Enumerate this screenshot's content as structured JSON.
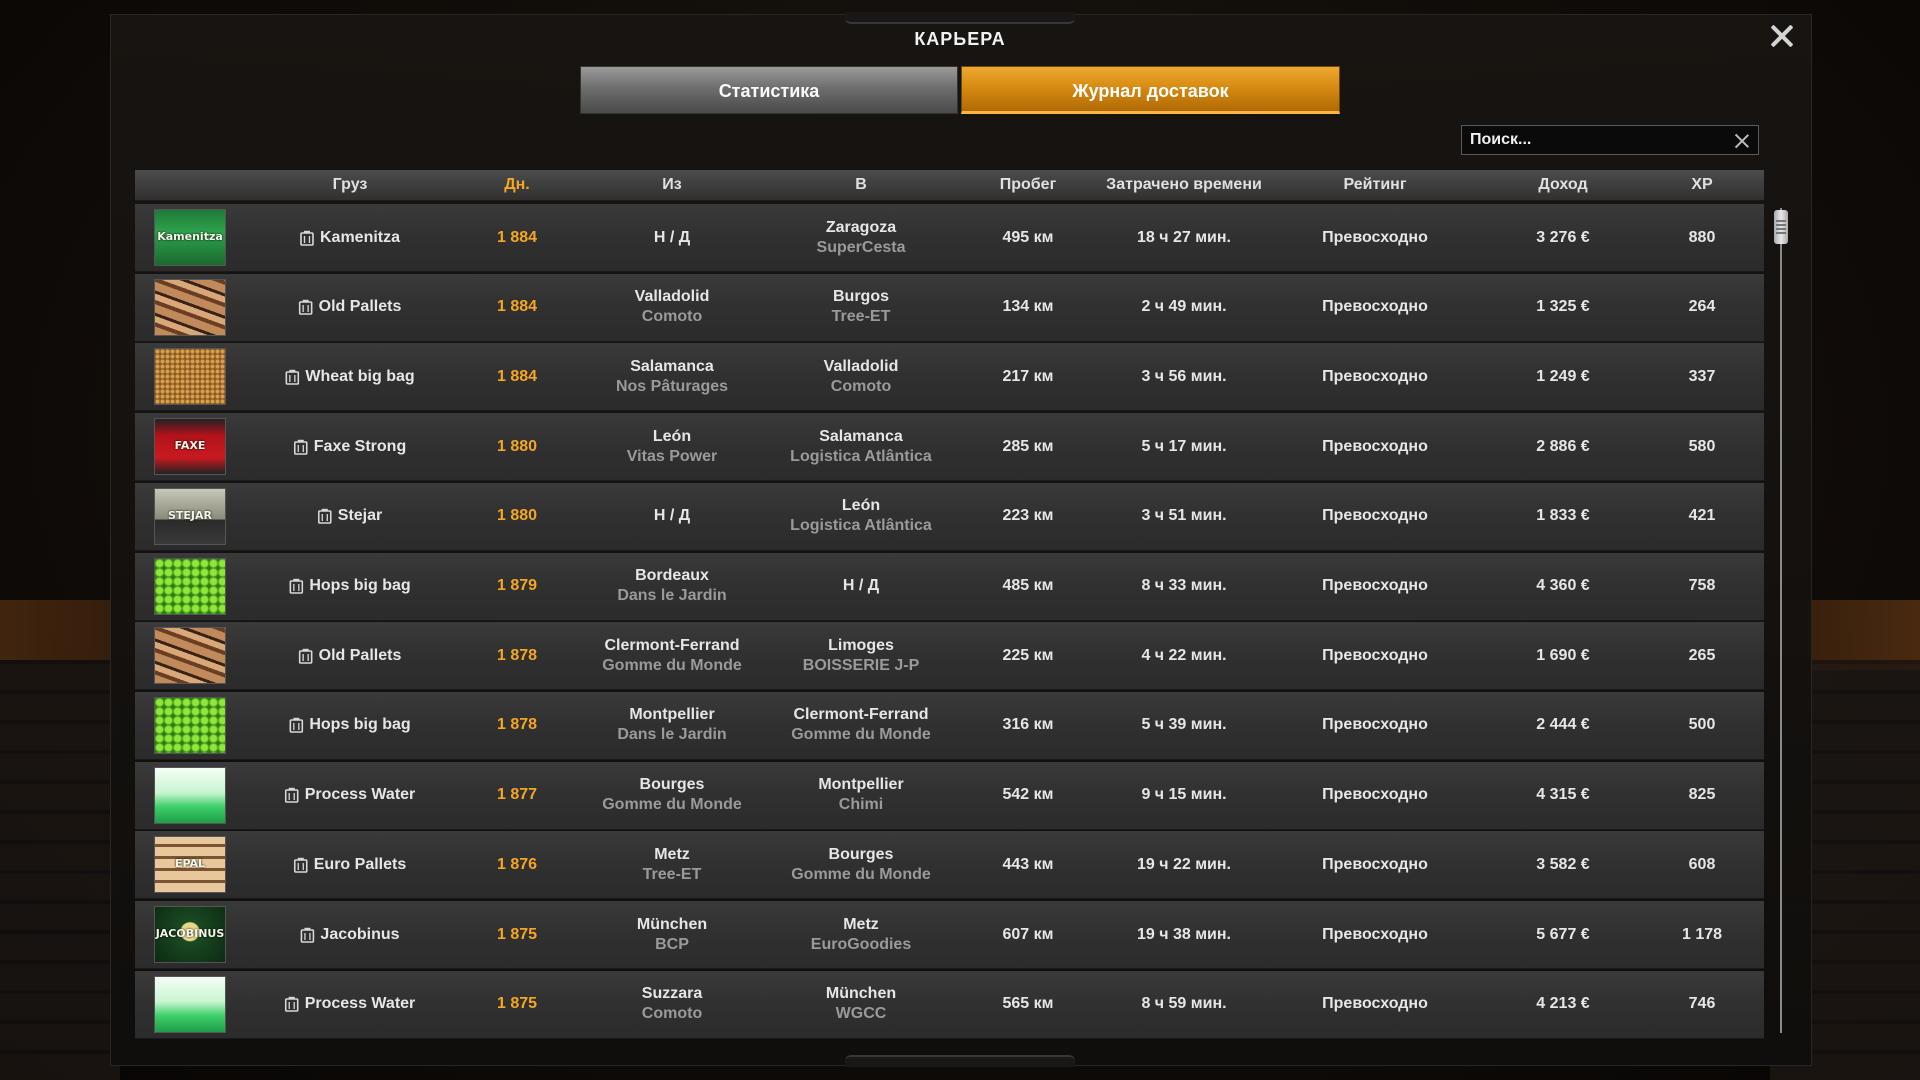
{
  "window": {
    "title": "КАРЬЕРА"
  },
  "tabs": [
    {
      "label": "Статистика",
      "active": false
    },
    {
      "label": "Журнал доставок",
      "active": true
    }
  ],
  "search": {
    "placeholder": "Поиск...",
    "value": ""
  },
  "table": {
    "columns": [
      "Груз",
      "Дн.",
      "Из",
      "В",
      "Пробег",
      "Затрачено времени",
      "Рейтинг",
      "Доход",
      "XP"
    ],
    "sorted_column": "Дн.",
    "rows": [
      {
        "image": "kamenitza-beer",
        "cargo": "Kamenitza",
        "day": "1 884",
        "from_city": "Н / Д",
        "from_company": "",
        "to_city": "Zaragoza",
        "to_company": "SuperCesta",
        "distance": "495 км",
        "time": "18 ч 27 мин.",
        "rating": "Превосходно",
        "income": "3 276 €",
        "xp": "880"
      },
      {
        "image": "old-pallets",
        "cargo": "Old Pallets",
        "day": "1 884",
        "from_city": "Valladolid",
        "from_company": "Comoto",
        "to_city": "Burgos",
        "to_company": "Tree-ET",
        "distance": "134 км",
        "time": "2 ч 49 мин.",
        "rating": "Превосходно",
        "income": "1 325 €",
        "xp": "264"
      },
      {
        "image": "wheat",
        "cargo": "Wheat big bag",
        "day": "1 884",
        "from_city": "Salamanca",
        "from_company": "Nos Pâturages",
        "to_city": "Valladolid",
        "to_company": "Comoto",
        "distance": "217 км",
        "time": "3 ч 56 мин.",
        "rating": "Превосходно",
        "income": "1 249 €",
        "xp": "337"
      },
      {
        "image": "faxe-beer",
        "cargo": "Faxe Strong",
        "day": "1 880",
        "from_city": "León",
        "from_company": "Vitas Power",
        "to_city": "Salamanca",
        "to_company": "Logistica Atlântica",
        "distance": "285 км",
        "time": "5 ч 17 мин.",
        "rating": "Превосходно",
        "income": "2 886 €",
        "xp": "580"
      },
      {
        "image": "stejar-beer",
        "cargo": "Stejar",
        "day": "1 880",
        "from_city": "Н / Д",
        "from_company": "",
        "to_city": "León",
        "to_company": "Logistica Atlântica",
        "distance": "223 км",
        "time": "3 ч 51 мин.",
        "rating": "Превосходно",
        "income": "1 833 €",
        "xp": "421"
      },
      {
        "image": "hops",
        "cargo": "Hops big bag",
        "day": "1 879",
        "from_city": "Bordeaux",
        "from_company": "Dans le Jardin",
        "to_city": "Н / Д",
        "to_company": "",
        "distance": "485 км",
        "time": "8 ч 33 мин.",
        "rating": "Превосходно",
        "income": "4 360 €",
        "xp": "758"
      },
      {
        "image": "old-pallets",
        "cargo": "Old Pallets",
        "day": "1 878",
        "from_city": "Clermont-Ferrand",
        "from_company": "Gomme du Monde",
        "to_city": "Limoges",
        "to_company": "BOISSERIE J-P",
        "distance": "225 км",
        "time": "4 ч 22 мин.",
        "rating": "Превосходно",
        "income": "1 690 €",
        "xp": "265"
      },
      {
        "image": "hops",
        "cargo": "Hops big bag",
        "day": "1 878",
        "from_city": "Montpellier",
        "from_company": "Dans le Jardin",
        "to_city": "Clermont-Ferrand",
        "to_company": "Gomme du Monde",
        "distance": "316 км",
        "time": "5 ч 39 мин.",
        "rating": "Превосходно",
        "income": "2 444 €",
        "xp": "500"
      },
      {
        "image": "water",
        "cargo": "Process Water",
        "day": "1 877",
        "from_city": "Bourges",
        "from_company": "Gomme du Monde",
        "to_city": "Montpellier",
        "to_company": "Chimi",
        "distance": "542 км",
        "time": "9 ч 15 мин.",
        "rating": "Превосходно",
        "income": "4 315 €",
        "xp": "825"
      },
      {
        "image": "euro-pallets",
        "cargo": "Euro Pallets",
        "day": "1 876",
        "from_city": "Metz",
        "from_company": "Tree-ET",
        "to_city": "Bourges",
        "to_company": "Gomme du Monde",
        "distance": "443 км",
        "time": "19 ч 22 мин.",
        "rating": "Превосходно",
        "income": "3 582 €",
        "xp": "608"
      },
      {
        "image": "jacobinus-beer",
        "cargo": "Jacobinus",
        "day": "1 875",
        "from_city": "München",
        "from_company": "BCP",
        "to_city": "Metz",
        "to_company": "EuroGoodies",
        "distance": "607 км",
        "time": "19 ч 38 мин.",
        "rating": "Превосходно",
        "income": "5 677 €",
        "xp": "1 178"
      },
      {
        "image": "water",
        "cargo": "Process Water",
        "day": "1 875",
        "from_city": "Suzzara",
        "from_company": "Comoto",
        "to_city": "München",
        "to_company": "WGCC",
        "distance": "565 км",
        "time": "8 ч 59 мин.",
        "rating": "Превосходно",
        "income": "4 213 €",
        "xp": "746"
      }
    ]
  },
  "thumb_labels": {
    "kamenitza-beer": "Kamenitza",
    "faxe-beer": "FAXE",
    "stejar-beer": "STEJAR",
    "jacobinus-beer": "JACOBINUS",
    "euro-pallets": "EPAL"
  },
  "colors": {
    "accent": "#f5a623",
    "tab_active": "#d48810",
    "row_bg": "#333333",
    "subtext": "#9a9a9a"
  }
}
